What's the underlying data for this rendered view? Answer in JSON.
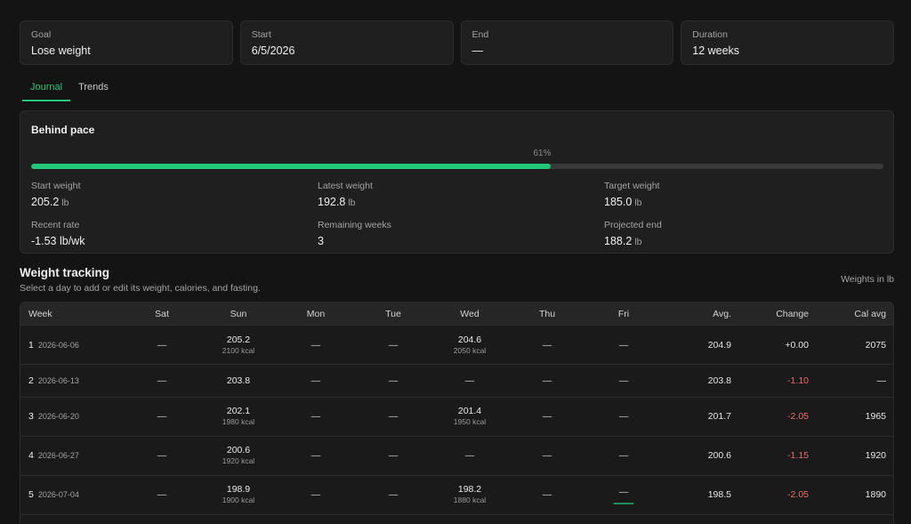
{
  "summary": [
    {
      "label": "Goal",
      "value": "Lose weight"
    },
    {
      "label": "Start",
      "value": "6/5/2026"
    },
    {
      "label": "End",
      "value": "—"
    },
    {
      "label": "Duration",
      "value": "12 weeks"
    }
  ],
  "tabs": [
    {
      "label": "Journal",
      "active": true
    },
    {
      "label": "Trends",
      "active": false
    }
  ],
  "pace": {
    "title": "Behind pace",
    "progress_label": "61%",
    "progress_fraction": 0.61,
    "stats": [
      {
        "label": "Start weight",
        "value": "205.2",
        "unit": "lb"
      },
      {
        "label": "Latest weight",
        "value": "192.8",
        "unit": "lb"
      },
      {
        "label": "Target weight",
        "value": "185.0",
        "unit": "lb"
      },
      {
        "label": "Recent rate",
        "value": "-1.53 lb/wk",
        "unit": ""
      },
      {
        "label": "Remaining weeks",
        "value": "3",
        "unit": ""
      },
      {
        "label": "Projected end",
        "value": "188.2",
        "unit": "lb"
      }
    ]
  },
  "tracking": {
    "title": "Weight tracking",
    "subtitle": "Select a day to add or edit its weight, calories, and fasting.",
    "units_note": "Weights in lb",
    "columns": [
      "Week",
      "Sat",
      "Sun",
      "Mon",
      "Tue",
      "Wed",
      "Thu",
      "Fri",
      "Avg.",
      "Change",
      "Cal avg"
    ],
    "rows": [
      {
        "week": "1",
        "date": "2026-06-06",
        "days": [
          {
            "w": "—"
          },
          {
            "w": "205.2",
            "kcal": "2100 kcal"
          },
          {
            "w": "—"
          },
          {
            "w": "—"
          },
          {
            "w": "204.6",
            "kcal": "2050 kcal"
          },
          {
            "w": "—"
          },
          {
            "w": "—"
          }
        ],
        "avg": "204.9",
        "change": "+0.00",
        "change_negative": false,
        "cal_avg": "2075"
      },
      {
        "week": "2",
        "date": "2026-06-13",
        "days": [
          {
            "w": "—"
          },
          {
            "w": "203.8"
          },
          {
            "w": "—"
          },
          {
            "w": "—"
          },
          {
            "w": "—"
          },
          {
            "w": "—"
          },
          {
            "w": "—"
          }
        ],
        "avg": "203.8",
        "change": "-1.10",
        "change_negative": true,
        "cal_avg": "—"
      },
      {
        "week": "3",
        "date": "2026-06-20",
        "days": [
          {
            "w": "—"
          },
          {
            "w": "202.1",
            "kcal": "1980 kcal"
          },
          {
            "w": "—"
          },
          {
            "w": "—"
          },
          {
            "w": "201.4",
            "kcal": "1950 kcal"
          },
          {
            "w": "—"
          },
          {
            "w": "—"
          }
        ],
        "avg": "201.7",
        "change": "-2.05",
        "change_negative": true,
        "cal_avg": "1965"
      },
      {
        "week": "4",
        "date": "2026-06-27",
        "days": [
          {
            "w": "—"
          },
          {
            "w": "200.6",
            "kcal": "1920 kcal"
          },
          {
            "w": "—"
          },
          {
            "w": "—"
          },
          {
            "w": "—"
          },
          {
            "w": "—"
          },
          {
            "w": "—"
          }
        ],
        "avg": "200.6",
        "change": "-1.15",
        "change_negative": true,
        "cal_avg": "1920"
      },
      {
        "week": "5",
        "date": "2026-07-04",
        "days": [
          {
            "w": "—"
          },
          {
            "w": "198.9",
            "kcal": "1900 kcal"
          },
          {
            "w": "—"
          },
          {
            "w": "—"
          },
          {
            "w": "198.2",
            "kcal": "1880 kcal"
          },
          {
            "w": "—"
          },
          {
            "w": "—",
            "today": true
          }
        ],
        "avg": "198.5",
        "change": "-2.05",
        "change_negative": true,
        "cal_avg": "1890"
      }
    ]
  }
}
